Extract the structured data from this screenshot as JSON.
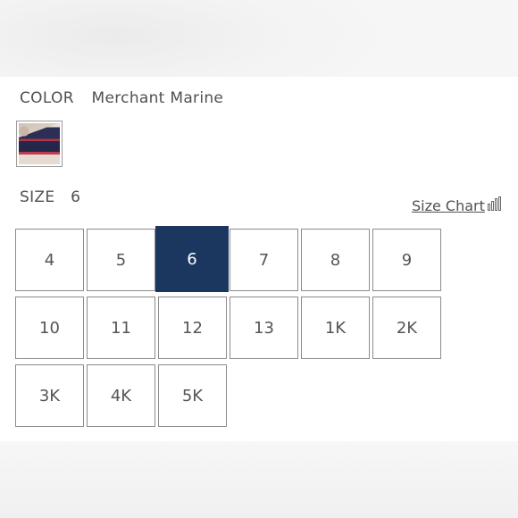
{
  "color": {
    "label": "COLOR",
    "value": "Merchant Marine",
    "swatch": {
      "name": "Merchant Marine",
      "colors": [
        "#2b2f55",
        "#c23a52",
        "#e9dfd6"
      ]
    }
  },
  "size": {
    "label": "SIZE",
    "selected": "6",
    "chart_link": "Size Chart",
    "options": [
      "4",
      "5",
      "6",
      "7",
      "8",
      "9",
      "10",
      "11",
      "12",
      "13",
      "1K",
      "2K",
      "3K",
      "4K",
      "5K"
    ]
  },
  "colors": {
    "selected_bg": "#1b3760",
    "border": "#8c8c8c",
    "text": "#555555"
  },
  "icons": {
    "size_chart": "ruler-bars-icon"
  }
}
